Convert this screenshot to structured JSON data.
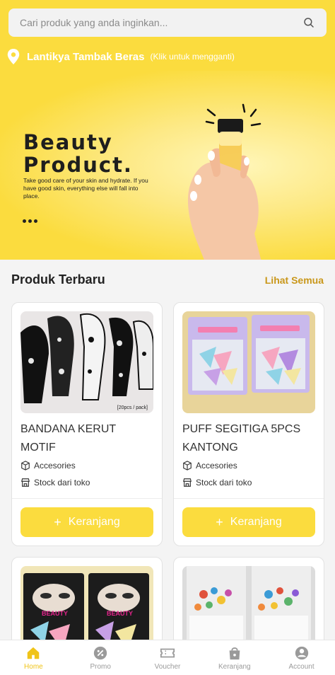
{
  "search": {
    "placeholder": "Cari produk yang anda inginkan..."
  },
  "location": {
    "name": "Lantikya Tambak Beras",
    "hint": "(Klik untuk mengganti)"
  },
  "banner": {
    "title_line1": "Beauty",
    "title_line2": "Product.",
    "subtitle": "Take good care of your skin and hydrate. If you have good skin, everything else will fall into place."
  },
  "section": {
    "title": "Produk Terbaru",
    "link": "Lihat Semua"
  },
  "products": [
    {
      "name": "BANDANA KERUT MOTIF",
      "category": "Accesories",
      "stock": "Stock dari toko",
      "button": "Keranjang",
      "tag": "[20pcs / pack]"
    },
    {
      "name": "PUFF SEGITIGA 5PCS KANTONG",
      "category": "Accesories",
      "stock": "Stock dari toko",
      "button": "Keranjang",
      "tag": ""
    },
    {
      "name": "",
      "category": "",
      "stock": "",
      "button": "",
      "tag": ""
    },
    {
      "name": "",
      "category": "",
      "stock": "",
      "button": "",
      "tag": ""
    }
  ],
  "tabs": [
    {
      "label": "Home",
      "icon": "home-icon",
      "active": true
    },
    {
      "label": "Promo",
      "icon": "promo-icon",
      "active": false
    },
    {
      "label": "Voucher",
      "icon": "voucher-icon",
      "active": false
    },
    {
      "label": "Keranjang",
      "icon": "bag-icon",
      "active": false
    },
    {
      "label": "Account",
      "icon": "account-icon",
      "active": false
    }
  ],
  "colors": {
    "brand": "#fbdc3e",
    "accent_text": "#c9971a",
    "active_tab": "#f0c419"
  }
}
